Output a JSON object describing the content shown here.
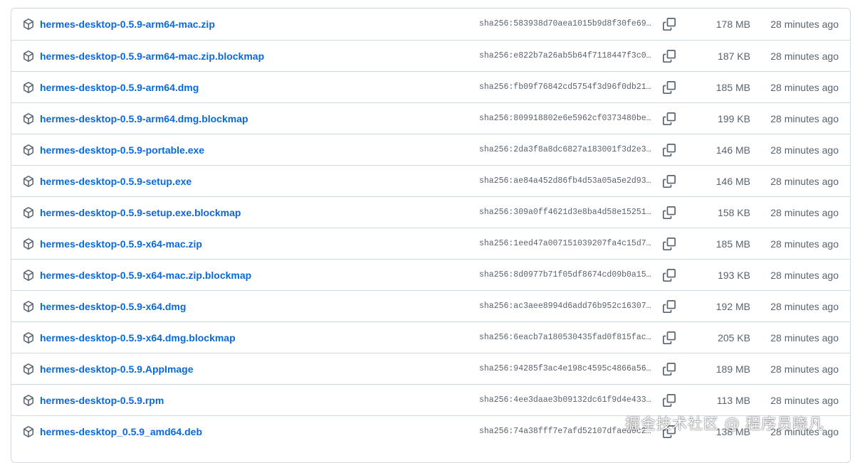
{
  "assets": [
    {
      "name": "hermes-desktop-0.5.9-arm64-mac.zip",
      "sha": "sha256:583938d70aea1015b9d8f30fe69dc...",
      "size": "178 MB",
      "time": "28 minutes ago"
    },
    {
      "name": "hermes-desktop-0.5.9-arm64-mac.zip.blockmap",
      "sha": "sha256:e822b7a26ab5b64f7118447f3c088...",
      "size": "187 KB",
      "time": "28 minutes ago"
    },
    {
      "name": "hermes-desktop-0.5.9-arm64.dmg",
      "sha": "sha256:fb09f76842cd5754f3d96f0db2103...",
      "size": "185 MB",
      "time": "28 minutes ago"
    },
    {
      "name": "hermes-desktop-0.5.9-arm64.dmg.blockmap",
      "sha": "sha256:809918802e6e5962cf0373480be60...",
      "size": "199 KB",
      "time": "28 minutes ago"
    },
    {
      "name": "hermes-desktop-0.5.9-portable.exe",
      "sha": "sha256:2da3f8a8dc6827a183001f3d2e3fd...",
      "size": "146 MB",
      "time": "28 minutes ago"
    },
    {
      "name": "hermes-desktop-0.5.9-setup.exe",
      "sha": "sha256:ae84a452d86fb4d53a05a5e2d9367...",
      "size": "146 MB",
      "time": "28 minutes ago"
    },
    {
      "name": "hermes-desktop-0.5.9-setup.exe.blockmap",
      "sha": "sha256:309a0ff4621d3e8ba4d58e1525186...",
      "size": "158 KB",
      "time": "28 minutes ago"
    },
    {
      "name": "hermes-desktop-0.5.9-x64-mac.zip",
      "sha": "sha256:1eed47a007151039207fa4c15d79b...",
      "size": "185 MB",
      "time": "28 minutes ago"
    },
    {
      "name": "hermes-desktop-0.5.9-x64-mac.zip.blockmap",
      "sha": "sha256:8d0977b71f05df8674cd09b0a15aa...",
      "size": "193 KB",
      "time": "28 minutes ago"
    },
    {
      "name": "hermes-desktop-0.5.9-x64.dmg",
      "sha": "sha256:ac3aee8994d6add76b952c16307b5...",
      "size": "192 MB",
      "time": "28 minutes ago"
    },
    {
      "name": "hermes-desktop-0.5.9-x64.dmg.blockmap",
      "sha": "sha256:6eacb7a180530435fad0f815fac79...",
      "size": "205 KB",
      "time": "28 minutes ago"
    },
    {
      "name": "hermes-desktop-0.5.9.AppImage",
      "sha": "sha256:94285f3ac4e198c4595c4866a56e0...",
      "size": "189 MB",
      "time": "28 minutes ago"
    },
    {
      "name": "hermes-desktop-0.5.9.rpm",
      "sha": "sha256:4ee3daae3b09132dc61f9d4e43302...",
      "size": "113 MB",
      "time": "28 minutes ago"
    },
    {
      "name": "hermes-desktop_0.5.9_amd64.deb",
      "sha": "sha256:74a38fff7e7afd52107dfaed0c20d...",
      "size": "138 MB",
      "time": "28 minutes ago"
    }
  ],
  "watermark": "掘金技术社区 @ 程序员晓凡",
  "icons": {
    "asset": "package-icon",
    "copy": "copy-icon"
  },
  "colors": {
    "link": "#0969da",
    "muted": "#59636e",
    "border": "#d1d9e0"
  }
}
